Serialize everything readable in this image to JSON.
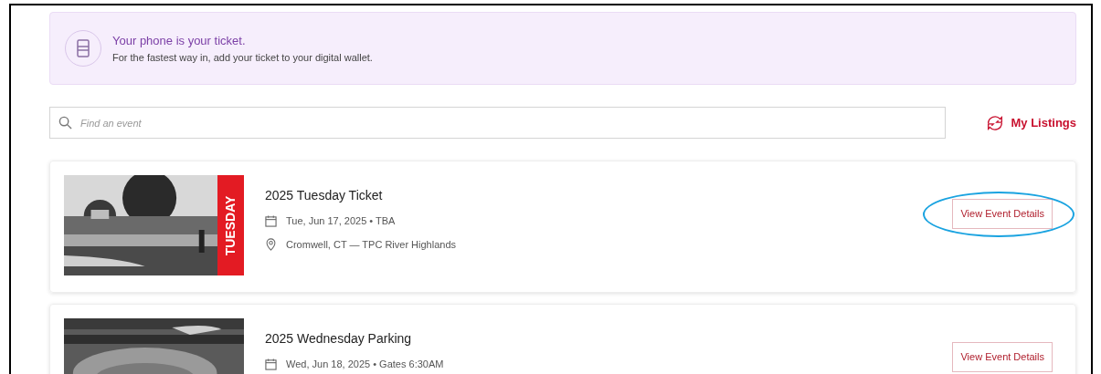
{
  "banner": {
    "title": "Your phone is your ticket.",
    "text": "For the fastest way in, add your ticket to your digital wallet."
  },
  "search": {
    "placeholder": "Find an event"
  },
  "my_listings": "My Listings",
  "events": [
    {
      "title": "2025 Tuesday Ticket",
      "day_tag": "TUESDAY",
      "date": "Tue, Jun 17, 2025 • TBA",
      "location": "Cromwell, CT — TPC River Highlands",
      "button": "View Event Details",
      "highlighted": true
    },
    {
      "title": "2025 Wednesday Parking",
      "date": "Wed, Jun 18, 2025 • Gates 6:30AM",
      "button": "View Event Details",
      "highlighted": false
    }
  ]
}
